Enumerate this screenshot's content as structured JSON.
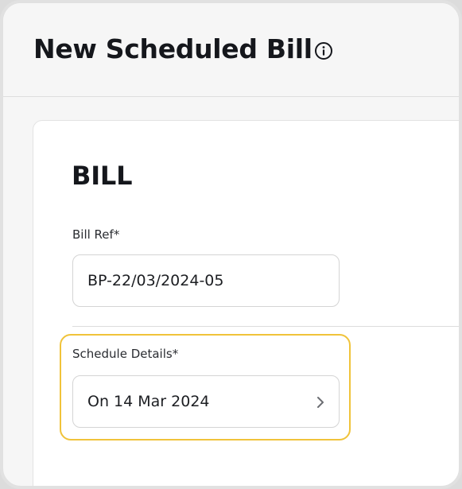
{
  "header": {
    "title": "New Scheduled Bill",
    "info_icon": "info-circle-icon"
  },
  "card": {
    "section_title": "BILL",
    "bill_ref": {
      "label": "Bill Ref*",
      "value": "BP-22/03/2024-05"
    },
    "schedule": {
      "label": "Schedule Details*",
      "value": "On 14 Mar 2024",
      "icon": "chevron-right-icon"
    }
  },
  "colors": {
    "highlight": "#f0c33a",
    "text": "#15171c",
    "border": "#d4d4d4"
  }
}
